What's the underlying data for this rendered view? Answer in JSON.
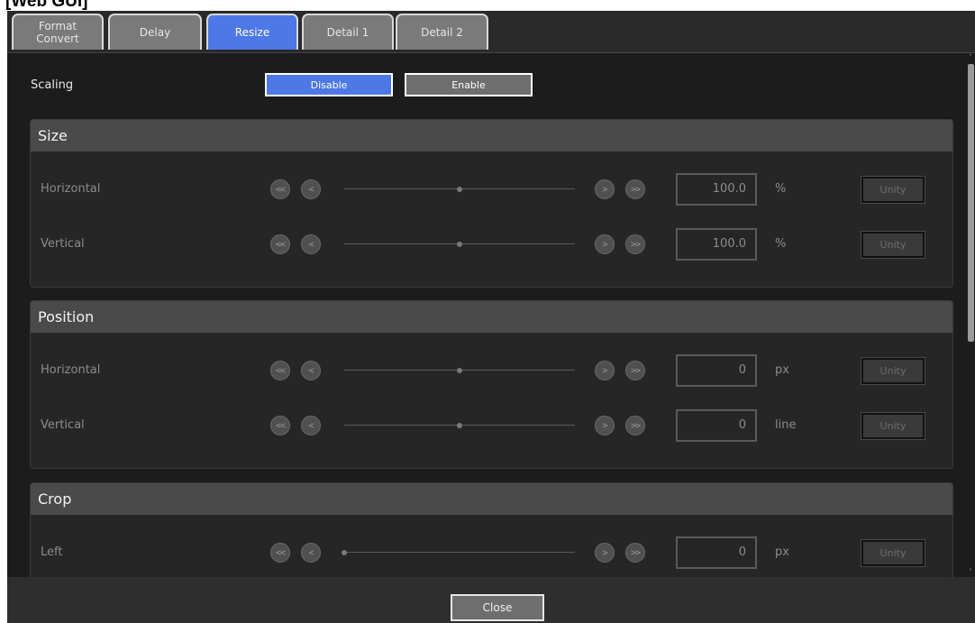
{
  "window_title": "[Web GUI]",
  "tabs": [
    {
      "label_line1": "Format",
      "label_line2": "Convert"
    },
    {
      "label": "Delay"
    },
    {
      "label": "Resize",
      "active": true
    },
    {
      "label": "Detail 1"
    },
    {
      "label": "Detail 2"
    }
  ],
  "scaling": {
    "label": "Scaling",
    "disable_label": "Disable",
    "enable_label": "Enable",
    "selected": "Disable"
  },
  "sections": [
    {
      "title": "Size",
      "rows": [
        {
          "label": "Horizontal",
          "value": "100.0",
          "unit": "%",
          "unity_label": "Unity",
          "slider_level": 0.5
        },
        {
          "label": "Vertical",
          "value": "100.0",
          "unit": "%",
          "unity_label": "Unity",
          "slider_level": 0.5
        }
      ]
    },
    {
      "title": "Position",
      "rows": [
        {
          "label": "Horizontal",
          "value": "0",
          "unit": "px",
          "unity_label": "Unity",
          "slider_level": 0.5
        },
        {
          "label": "Vertical",
          "value": "0",
          "unit": "line",
          "unity_label": "Unity",
          "slider_level": 0.5
        }
      ]
    },
    {
      "title": "Crop",
      "rows": [
        {
          "label": "Left",
          "value": "0",
          "unit": "px",
          "unity_label": "Unity",
          "slider_level": 0.0
        }
      ]
    }
  ],
  "step_buttons": {
    "fast_back": "<<",
    "back": "<",
    "fwd": ">",
    "fast_fwd": ">>"
  },
  "footer": {
    "close_label": "Close"
  },
  "colors": {
    "accent": "#4d78e6",
    "background": "#1c1c1c",
    "panel_header": "#4a4a4a"
  }
}
